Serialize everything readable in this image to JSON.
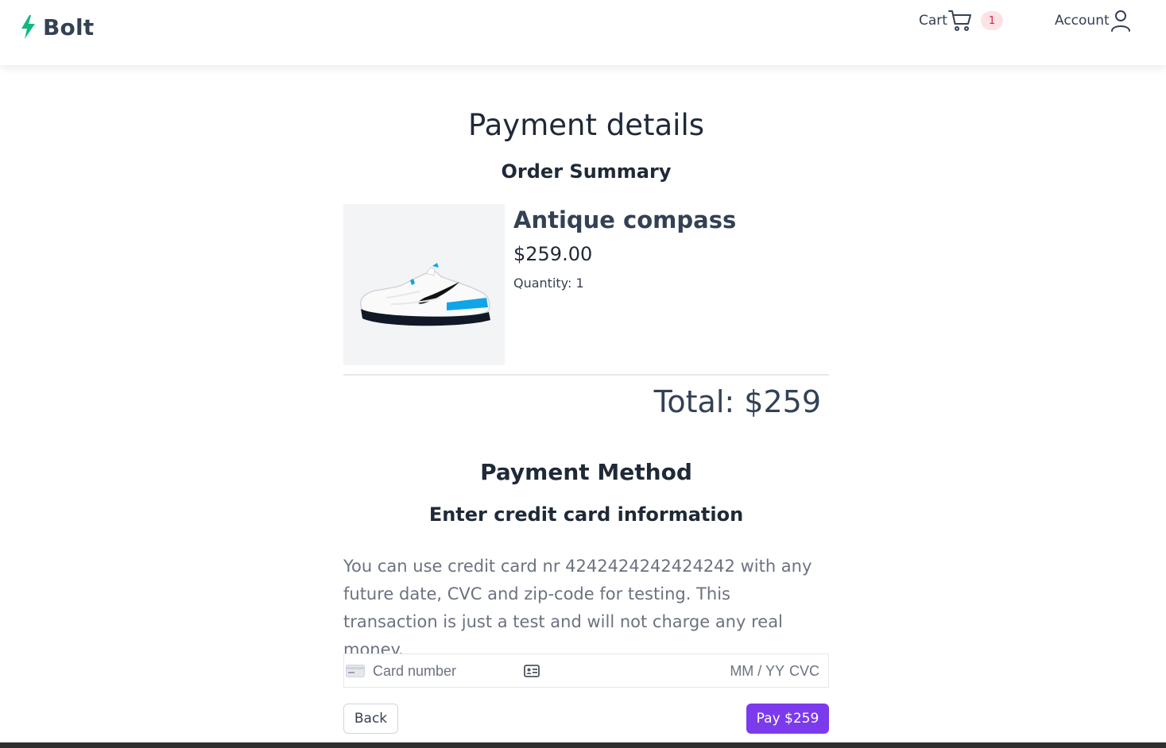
{
  "header": {
    "brand": "Bolt",
    "cart_label": "Cart",
    "cart_count": "1",
    "account_label": "Account"
  },
  "page": {
    "title": "Payment details",
    "order_summary_heading": "Order Summary"
  },
  "order": {
    "item": {
      "name": "Antique compass",
      "price": "$259.00",
      "quantity": "Quantity: 1",
      "image_icon": "sneaker-product-image"
    },
    "total": "Total: $259"
  },
  "payment": {
    "heading": "Payment Method",
    "subheading": "Enter credit card information",
    "note": "You can use credit card nr 4242424242424242 with any future date, CVC and zip-code for testing. This transaction is just a test and will not charge any real money.",
    "card_number_placeholder": "Card number",
    "expiry_placeholder": "MM / YY",
    "cvc_placeholder": "CVC"
  },
  "actions": {
    "back_label": "Back",
    "pay_label": "Pay $259"
  },
  "colors": {
    "brand_green": "#10b981",
    "pay_purple": "#7c3aed",
    "badge_bg": "#fde2e4",
    "badge_text": "#e11d48"
  }
}
